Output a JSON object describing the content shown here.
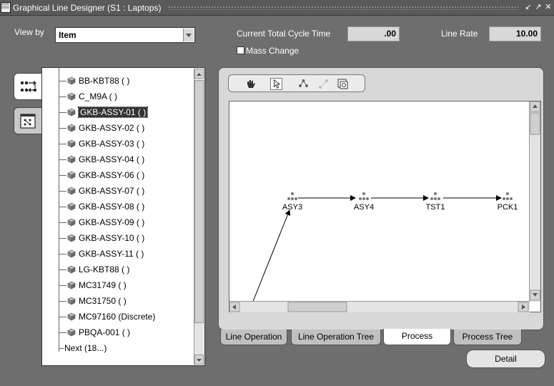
{
  "window": {
    "title": "Graphical Line Designer (S1 : Laptops)"
  },
  "header": {
    "view_by_label": "View by",
    "view_by_value": "Item",
    "cycle_time_label": "Current Total Cycle Time",
    "cycle_time_value": ".00",
    "line_rate_label": "Line Rate",
    "line_rate_value": "10.00",
    "mass_change_label": "Mass Change"
  },
  "tree": {
    "items": [
      {
        "label": "BB-KBT88 ( )"
      },
      {
        "label": "C_M9A ( )"
      },
      {
        "label": "GKB-ASSY-01 ( )",
        "selected": true
      },
      {
        "label": "GKB-ASSY-02 ( )"
      },
      {
        "label": "GKB-ASSY-03 ( )"
      },
      {
        "label": "GKB-ASSY-04 ( )"
      },
      {
        "label": "GKB-ASSY-06 ( )"
      },
      {
        "label": "GKB-ASSY-07 ( )"
      },
      {
        "label": "GKB-ASSY-08 ( )"
      },
      {
        "label": "GKB-ASSY-09 ( )"
      },
      {
        "label": "GKB-ASSY-10 ( )"
      },
      {
        "label": "GKB-ASSY-11 ( )"
      },
      {
        "label": "LG-KBT88 ( )"
      },
      {
        "label": "MC31749 ( )"
      },
      {
        "label": "MC31750 ( )"
      },
      {
        "label": "MC97160 (Discrete)"
      },
      {
        "label": "PBQA-001 ( )"
      }
    ],
    "next_label": "Next (18...)"
  },
  "diagram": {
    "nodes": [
      {
        "label": "ASY3"
      },
      {
        "label": "ASY4"
      },
      {
        "label": "TST1"
      },
      {
        "label": "PCK1"
      }
    ]
  },
  "tabs": [
    {
      "label": "Line Operation"
    },
    {
      "label": "Line Operation Tree"
    },
    {
      "label": "Process",
      "active": true
    },
    {
      "label": "Process Tree"
    }
  ],
  "detail_label": "Detail",
  "icons": {
    "toolbar": [
      "hand-icon",
      "pointer-icon",
      "add-node-icon",
      "connect-icon",
      "properties-icon"
    ],
    "side_tabs": [
      "flow-icon",
      "graph-icon"
    ]
  }
}
